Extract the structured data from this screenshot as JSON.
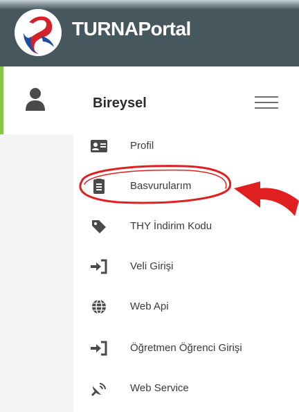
{
  "app": {
    "brand": "TURNAPortal"
  },
  "sidebar": {
    "section_title": "Bireysel",
    "items": [
      {
        "label": "Profil",
        "icon": "id-card-icon"
      },
      {
        "label": "Basvurularım",
        "icon": "clipboard-list-icon"
      },
      {
        "label": "THY İndirim Kodu",
        "icon": "tag-icon"
      },
      {
        "label": "Veli Girişi",
        "icon": "sign-in-icon"
      },
      {
        "label": "Web Api",
        "icon": "globe-icon"
      },
      {
        "label": "Öğretmen Öğrenci Girişi",
        "icon": "sign-in-icon"
      },
      {
        "label": "Web Service",
        "icon": "satellite-dish-icon"
      }
    ]
  },
  "colors": {
    "topbar": "#46575e",
    "accent_green": "#8cc34a",
    "icon_gray": "#4a4a4a",
    "annotation_red": "#e02020"
  },
  "annotation": {
    "highlighted_item": "Basvurularım"
  }
}
